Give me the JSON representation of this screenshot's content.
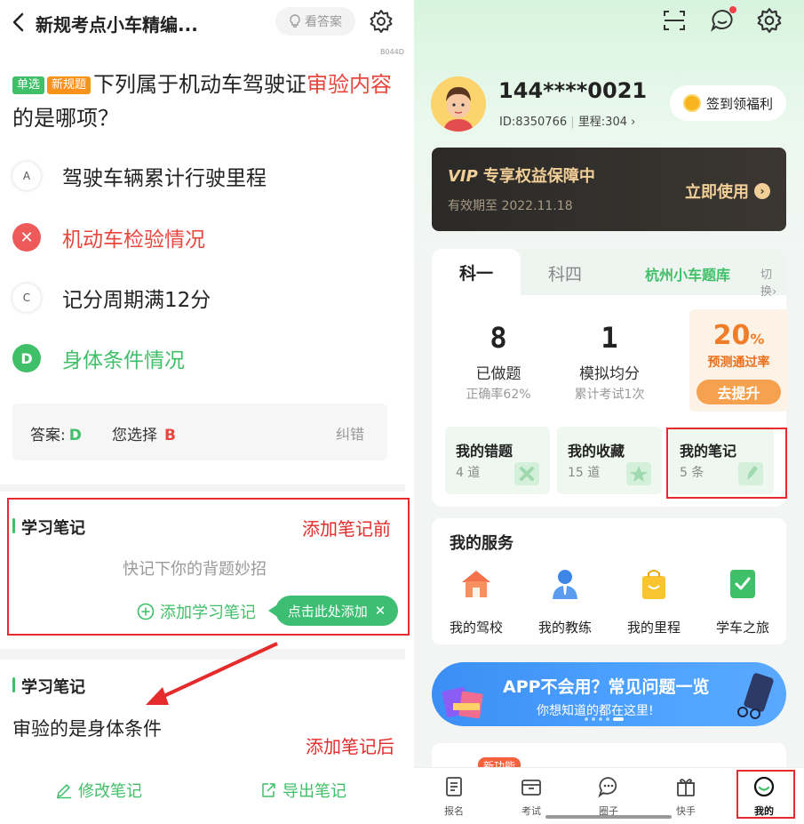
{
  "left": {
    "header": {
      "title": "新规考点小车精编...",
      "answer_button": "看答案",
      "code": "B044D"
    },
    "question": {
      "tags": [
        "单选",
        "新规题"
      ],
      "text_before": "下列属于机动车驾驶证",
      "text_highlight": "审验内容",
      "text_after": "的是哪项？"
    },
    "options": [
      {
        "badge": "A",
        "text": "驾驶车辆累计行驶里程",
        "state": "normal"
      },
      {
        "badge": "✕",
        "text": "机动车检验情况",
        "state": "wrong"
      },
      {
        "badge": "C",
        "text": "记分周期满12分",
        "state": "normal"
      },
      {
        "badge": "D",
        "text": "身体条件情况",
        "state": "right"
      }
    ],
    "answer_box": {
      "answer_label": "答案:",
      "answer_value": "D",
      "your_label": "您选择",
      "your_value": "B",
      "fix_label": "纠错"
    },
    "notes_before": {
      "header": "学习笔记",
      "annotation": "添加笔记前",
      "placeholder": "快记下你的背题妙招",
      "add_label": "添加学习笔记",
      "tooltip": "点击此处添加"
    },
    "notes_after": {
      "header": "学习笔记",
      "annotation": "添加笔记后",
      "content": "审验的是身体条件"
    },
    "bottom": {
      "edit_label": "修改笔记",
      "export_label": "导出笔记"
    }
  },
  "right": {
    "user": {
      "phone": "144****0021",
      "id": "ID:8350766",
      "mileage": "里程:304 ›",
      "checkin_label": "签到领福利"
    },
    "vip": {
      "badge": "VIP",
      "title": "专享权益保障中",
      "expire": "有效期至 2022.11.18",
      "button": "立即使用"
    },
    "stats": {
      "tab_active": "科一",
      "tab_inactive": "科四",
      "bank_name": "杭州小车题库",
      "bank_switch": "切换›",
      "done_num": "8",
      "done_label": "已做题",
      "done_sub": "正确率62%",
      "mock_num": "1",
      "mock_label": "模拟均分",
      "mock_sub": "累计考试1次",
      "pass_num": "20",
      "pass_unit": "%",
      "pass_label": "预测通过率",
      "pass_button": "去提升"
    },
    "mini_cards": [
      {
        "title": "我的错题",
        "count": "4 道"
      },
      {
        "title": "我的收藏",
        "count": "15 道"
      },
      {
        "title": "我的笔记",
        "count": "5 条"
      }
    ],
    "services": {
      "title": "我的服务",
      "items": [
        "我的驾校",
        "我的教练",
        "我的里程",
        "学车之旅"
      ]
    },
    "banner": {
      "title": "APP不会用？常见问题一览",
      "subtitle": "你想知道的都在这里!"
    },
    "new_badge": "新功能",
    "tabbar": [
      "报名",
      "考试",
      "圈子",
      "快手",
      "我的"
    ],
    "colors": {
      "accent": "#3fbf67",
      "alert": "#e52b2b",
      "vip_gold": "#f1cf97"
    }
  }
}
